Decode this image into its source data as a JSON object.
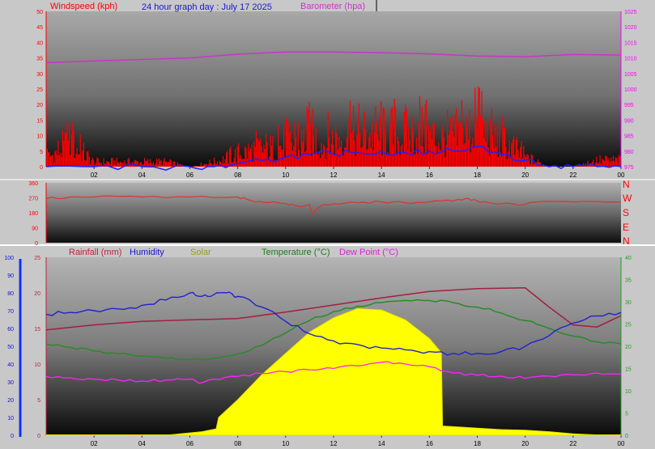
{
  "page_title": "24 hour graph day : July 17 2025",
  "colors": {
    "windspeed": "#ff0000",
    "windspeed_avg": "#2020ff",
    "barometer": "#cc33cc",
    "direction": "#dd3333",
    "humidity": "#2222cc",
    "temperature": "#2a8a2a",
    "dewpoint": "#ff22ff",
    "rainfall": "#a02040",
    "solar": "#ffff00"
  },
  "compass_letters": [
    "N",
    "W",
    "S",
    "E",
    "N"
  ],
  "chart_data": [
    {
      "id": "wind",
      "type": "line",
      "title": "24 hour graph day : July 17 2025",
      "legend": [
        "Windspeed (kph)",
        "Barometer (hpa)"
      ],
      "x_ticks": [
        "02",
        "04",
        "06",
        "08",
        "10",
        "12",
        "14",
        "16",
        "18",
        "20",
        "22",
        "00"
      ],
      "xlim": [
        0,
        24
      ],
      "y_left": {
        "label": "Windspeed (kph)",
        "ticks": [
          0,
          5,
          10,
          15,
          20,
          25,
          30,
          35,
          40,
          45,
          50
        ],
        "lim": [
          0,
          50
        ]
      },
      "y_right": {
        "label": "Barometer (hpa)",
        "ticks": [
          975,
          980,
          985,
          990,
          995,
          1000,
          1005,
          1010,
          1015,
          1020,
          1025
        ],
        "lim": [
          975,
          1025
        ]
      },
      "series": [
        {
          "name": "Barometer (hpa)",
          "axis": "right",
          "x": [
            0,
            2,
            4,
            6,
            8,
            10,
            12,
            14,
            16,
            18,
            20,
            22,
            24
          ],
          "y": [
            1008.5,
            1009,
            1009.5,
            1010,
            1011.2,
            1011.9,
            1011.9,
            1011.7,
            1011.3,
            1010.6,
            1010.4,
            1011.1,
            1010.9
          ]
        },
        {
          "name": "Windspeed (kph)",
          "axis": "left",
          "style": "spikes",
          "x": [
            0,
            1,
            2,
            3,
            4,
            5,
            6,
            7,
            7.5,
            8,
            8.5,
            9,
            9.5,
            10,
            10.5,
            11,
            11.5,
            12,
            12.5,
            13,
            13.5,
            14,
            14.5,
            15,
            15.5,
            16,
            16.5,
            17,
            17.5,
            18,
            18.5,
            19,
            19.5,
            20,
            21,
            22,
            23,
            24
          ],
          "y": [
            5,
            15,
            3,
            3,
            3,
            3,
            0,
            3,
            5,
            8,
            10,
            12,
            11,
            15,
            13,
            20,
            16,
            18,
            21,
            19,
            22,
            20,
            21,
            19,
            22,
            20,
            18,
            19,
            21,
            25,
            20,
            16,
            12,
            6,
            0,
            0,
            4,
            4
          ]
        },
        {
          "name": "Windspeed average",
          "axis": "left",
          "x": [
            0,
            2,
            4,
            6,
            7,
            8,
            9,
            10,
            11,
            12,
            13,
            14,
            15,
            16,
            17,
            18,
            19,
            20,
            21,
            22,
            23,
            24
          ],
          "y": [
            0,
            0,
            0,
            0,
            0,
            1,
            2,
            3,
            4,
            4,
            4.5,
            5,
            4.5,
            5,
            5,
            6.5,
            4,
            2,
            0,
            0,
            0,
            0
          ]
        }
      ]
    },
    {
      "id": "direction",
      "type": "line",
      "x_ticks": [],
      "xlim": [
        0,
        24
      ],
      "y_left": {
        "ticks": [
          0,
          90,
          180,
          270,
          360
        ],
        "lim": [
          0,
          360
        ]
      },
      "series": [
        {
          "name": "Wind direction",
          "axis": "left",
          "x": [
            0,
            1,
            2,
            4,
            6,
            8,
            8.5,
            9,
            10,
            10.5,
            11,
            11.1,
            11.5,
            12,
            13,
            14,
            15,
            16,
            17,
            17.5,
            18,
            18.5,
            19,
            20,
            20.5,
            22,
            24
          ],
          "y": [
            265,
            275,
            275,
            275,
            275,
            275,
            255,
            245,
            235,
            220,
            230,
            170,
            225,
            235,
            240,
            245,
            240,
            245,
            250,
            265,
            250,
            240,
            235,
            230,
            245,
            245,
            245
          ]
        }
      ]
    },
    {
      "id": "weather",
      "type": "line",
      "legend": [
        "Rainfall (mm)",
        "Humidity",
        "Solar",
        "Temperature (°C)",
        "Dew Point (°C)"
      ],
      "x_ticks": [
        "02",
        "04",
        "06",
        "08",
        "10",
        "12",
        "14",
        "16",
        "18",
        "20",
        "22",
        "00"
      ],
      "xlim": [
        0,
        24
      ],
      "y_far_left": {
        "label": "Humidity",
        "ticks": [
          0,
          10,
          20,
          30,
          40,
          50,
          60,
          70,
          80,
          90,
          100
        ],
        "lim": [
          0,
          100
        ]
      },
      "y_left": {
        "label": "Rainfall (mm)",
        "ticks": [
          0,
          5,
          10,
          15,
          20,
          25
        ],
        "lim": [
          0,
          25
        ]
      },
      "y_right": {
        "label": "Temperature (°C)",
        "ticks": [
          0,
          5,
          10,
          15,
          20,
          25,
          30,
          35,
          40
        ],
        "lim": [
          0,
          40
        ]
      },
      "series": [
        {
          "name": "Solar",
          "axis": "left",
          "style": "area",
          "x": [
            0,
            5,
            6.5,
            7.1,
            7.2,
            8,
            9,
            10,
            11,
            12,
            13,
            14,
            15,
            16,
            16.5,
            16.55,
            17,
            18,
            19,
            20,
            21,
            22,
            23,
            23.5,
            24
          ],
          "y": [
            0,
            0,
            0.5,
            0.9,
            2.5,
            5,
            8.5,
            11.5,
            14.5,
            16.5,
            17.8,
            17.6,
            16.2,
            13.6,
            11.6,
            1.3,
            1.2,
            1.0,
            0.8,
            0.7,
            0.5,
            0.2,
            0.05,
            0,
            0
          ]
        },
        {
          "name": "Humidity",
          "axis": "far_left",
          "x": [
            0,
            1,
            2,
            3,
            4,
            5,
            6,
            6.5,
            7,
            7.5,
            8,
            9,
            10,
            11,
            12,
            13,
            14,
            15,
            16,
            17,
            18,
            19,
            20,
            21,
            22,
            23,
            24
          ],
          "y": [
            68,
            69,
            70,
            71,
            73,
            76,
            80,
            78,
            79,
            80,
            78,
            72,
            64,
            57,
            53,
            51,
            49,
            48,
            47,
            46,
            46,
            47,
            50,
            56,
            63,
            67,
            69
          ]
        },
        {
          "name": "Temperature (°C)",
          "axis": "right",
          "x": [
            0,
            1,
            2,
            3,
            4,
            5,
            6,
            7,
            8,
            9,
            10,
            11,
            12,
            13,
            14,
            15,
            16,
            17,
            18,
            19,
            20,
            21,
            22,
            23,
            24
          ],
          "y": [
            20.5,
            19.8,
            18.9,
            18.3,
            17.8,
            17.3,
            17.0,
            17.3,
            18.3,
            20.2,
            23.0,
            25.8,
            27.8,
            29.0,
            29.8,
            30.3,
            30.3,
            29.8,
            28.8,
            27.5,
            25.8,
            24.0,
            22.3,
            21.0,
            20.5
          ]
        },
        {
          "name": "Dew Point (°C)",
          "axis": "right",
          "x": [
            0,
            1,
            2,
            3,
            4,
            5,
            6,
            6.5,
            7,
            8,
            9,
            10,
            11,
            12,
            13,
            14,
            15,
            16,
            17,
            18,
            19,
            20,
            21,
            22,
            23,
            24
          ],
          "y": [
            13.2,
            12.9,
            12.6,
            12.4,
            12.2,
            12.4,
            12.6,
            11.8,
            12.6,
            13.2,
            13.9,
            14.3,
            14.7,
            15.0,
            15.6,
            16.4,
            16.0,
            15.4,
            14.0,
            13.5,
            13.3,
            12.8,
            13.3,
            13.6,
            14.0,
            13.8
          ]
        },
        {
          "name": "Rainfall (mm)",
          "axis": "left",
          "x": [
            0,
            2,
            4,
            6,
            8,
            10,
            12,
            14,
            16,
            18,
            20,
            21,
            22,
            23,
            24
          ],
          "y": [
            14.8,
            15.5,
            16.0,
            16.2,
            16.4,
            17.3,
            18.3,
            19.3,
            20.2,
            20.6,
            20.7,
            18.0,
            15.5,
            15.2,
            16.8
          ]
        }
      ]
    }
  ]
}
